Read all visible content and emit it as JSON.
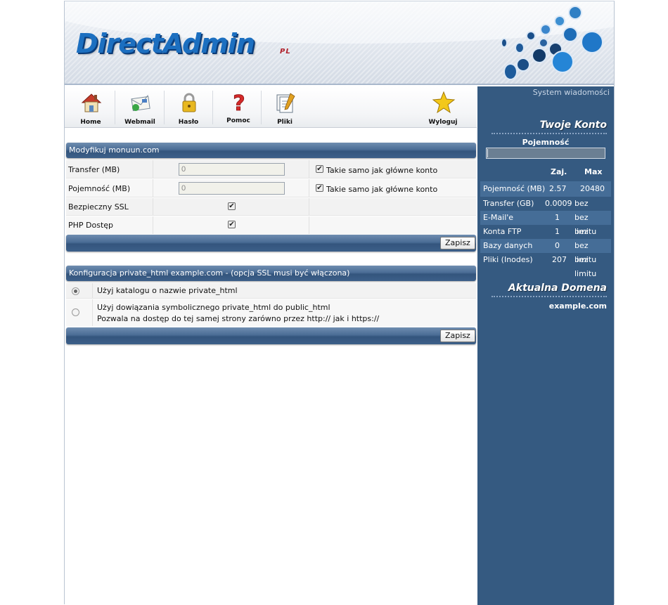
{
  "header": {
    "logo_text": "DirectAdmin",
    "logo_suffix": "PL"
  },
  "toolbar": {
    "items": [
      {
        "label": "Home",
        "icon": "home-icon"
      },
      {
        "label": "Webmail",
        "icon": "mail-icon"
      },
      {
        "label": "Hasło",
        "icon": "lock-icon"
      },
      {
        "label": "Pomoc",
        "icon": "help-icon"
      },
      {
        "label": "Pliki",
        "icon": "files-icon"
      },
      {
        "label": "Wyloguj",
        "icon": "star-icon"
      }
    ]
  },
  "modify": {
    "title": "Modyfikuj monuun.com",
    "rows": [
      {
        "label": "Transfer (MB)",
        "value": "0",
        "same_label": "Takie samo jak główne konto",
        "checked": true
      },
      {
        "label": "Pojemność (MB)",
        "value": "0",
        "same_label": "Takie samo jak główne konto",
        "checked": true
      },
      {
        "label": "Bezpieczny SSL",
        "checked": true
      },
      {
        "label": "PHP Dostęp",
        "checked": true
      }
    ],
    "save_label": "Zapisz"
  },
  "private_html": {
    "title": "Konfiguracja private_html example.com - (opcja SSL musi być włączona)",
    "option1": "Użyj katalogu o nazwie private_html",
    "option2_line1": "Użyj dowiązania symbolicznego private_html do public_html",
    "option2_line2": "Pozwala na dostęp do tej samej strony zarówno przez http:// jak i https://",
    "selected": 1,
    "save_label": "Zapisz"
  },
  "sidebar": {
    "system_messages": "System wiadomości",
    "account_title": "Twoje Konto",
    "capacity_label": "Pojemność",
    "capacity_used_fraction": 0.0001,
    "col_used": "Zaj.",
    "col_max": "Max",
    "stats": [
      {
        "name": "Pojemność (MB)",
        "used": "2.57",
        "max": "20480"
      },
      {
        "name": "Transfer (GB)",
        "used": "0.0009",
        "max": "bez limitu"
      },
      {
        "name": "E-Mail'e",
        "used": "1",
        "max": "bez limitu"
      },
      {
        "name": "Konta FTP",
        "used": "1",
        "max": "bez limitu"
      },
      {
        "name": "Bazy danych",
        "used": "0",
        "max": "bez limitu"
      },
      {
        "name": "Pliki (Inodes)",
        "used": "207",
        "max": "bez limitu"
      }
    ],
    "domain_title": "Aktualna Domena",
    "domain": "example.com"
  },
  "colors": {
    "sidebar_bg": "#355a81",
    "accent_blue": "#1c6fc0",
    "header_bar": "#4a6c95"
  }
}
